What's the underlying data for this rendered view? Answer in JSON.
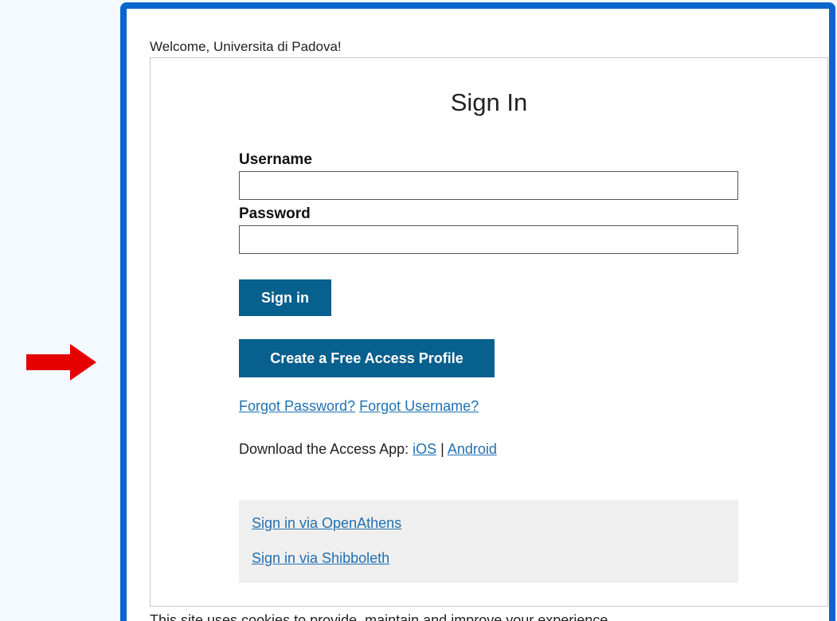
{
  "welcome_text": "Welcome, Universita di Padova!",
  "signin": {
    "title": "Sign In",
    "username_label": "Username",
    "username_value": "",
    "password_label": "Password",
    "password_value": "",
    "signin_button": "Sign in",
    "create_profile_button": "Create a Free Access Profile",
    "forgot_password": "Forgot Password?",
    "forgot_username": "Forgot Username?",
    "download_text": "Download the Access App: ",
    "ios_link": "iOS",
    "separator": " | ",
    "android_link": "Android"
  },
  "alternate": {
    "openathens": "Sign in via OpenAthens",
    "shibboleth": "Sign in via Shibboleth"
  },
  "footer_partial": "This site uses cookies to provide, maintain and improve your experience",
  "colors": {
    "accent_border": "#0a66cc",
    "button_bg": "#07608d",
    "link": "#2070b2",
    "arrow": "#e60000"
  },
  "icons": {
    "annotation_arrow": "right-arrow-icon"
  }
}
